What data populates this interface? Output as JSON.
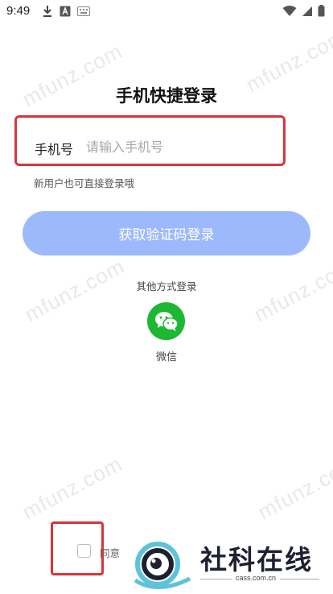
{
  "status_bar": {
    "time": "9:49"
  },
  "watermark": "mfunz.com",
  "login": {
    "title": "手机快捷登录",
    "phone_label": "手机号",
    "phone_placeholder": "请输入手机号",
    "hint": "新用户也可直接登录哦",
    "button_label": "获取验证码登录",
    "other_methods_label": "其他方式登录",
    "wechat_label": "微信",
    "agree_text": "同意",
    "agree_paren": "《"
  },
  "logo": {
    "title": "社科在线",
    "subtitle": "cass.com.cn"
  },
  "colors": {
    "button": "#9cbafb",
    "wechat": "#1db833",
    "highlight_border": "#d9343a"
  }
}
